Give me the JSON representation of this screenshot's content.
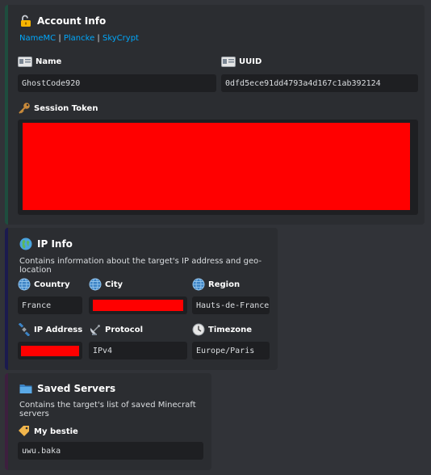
{
  "account": {
    "title": "Account Info",
    "title_icon": "unlocked-padlock-icon",
    "links": [
      "NameMC",
      "Plancke",
      "SkyCrypt"
    ],
    "separator": "|",
    "fields": {
      "name": {
        "label": "Name",
        "value": "GhostCode920",
        "icon": "id-card-icon"
      },
      "uuid": {
        "label": "UUID",
        "value": "0dfd5ece91dd4793a4d167c1ab392124",
        "icon": "id-card-icon"
      },
      "session": {
        "label": "Session Token",
        "value": "",
        "icon": "key-icon",
        "redacted": true
      }
    },
    "accent_color": "#1e4d3e"
  },
  "ip": {
    "title": "IP Info",
    "title_icon": "globe-europe-africa-icon",
    "description": "Contains information about the target's IP address and geo-location",
    "accent_color": "#1b1a4e",
    "fields": {
      "country": {
        "label": "Country",
        "value": "France",
        "icon": "globe-meridians-icon"
      },
      "city": {
        "label": "City",
        "value": "",
        "icon": "globe-meridians-icon",
        "redacted": true
      },
      "region": {
        "label": "Region",
        "value": "Hauts-de-France",
        "icon": "globe-meridians-icon"
      },
      "ip_address": {
        "label": "IP Address",
        "value": "",
        "icon": "satellite-icon",
        "redacted": true
      },
      "protocol": {
        "label": "Protocol",
        "value": "IPv4",
        "icon": "satellite-antenna-icon"
      },
      "timezone": {
        "label": "Timezone",
        "value": "Europe/Paris",
        "icon": "clock-icon"
      }
    }
  },
  "servers": {
    "title": "Saved Servers",
    "title_icon": "folder-icon",
    "description": "Contains the target's list of saved Minecraft servers",
    "accent_color": "#3d1f3e",
    "items": [
      {
        "label": "My bestie",
        "value": "uwu.baka",
        "icon": "label-tag-icon"
      }
    ]
  },
  "colors": {
    "background": "#313338",
    "embed_background": "#2b2d31",
    "code_background": "#1e1f22",
    "link": "#00a8fc",
    "redaction": "#ff0000"
  }
}
